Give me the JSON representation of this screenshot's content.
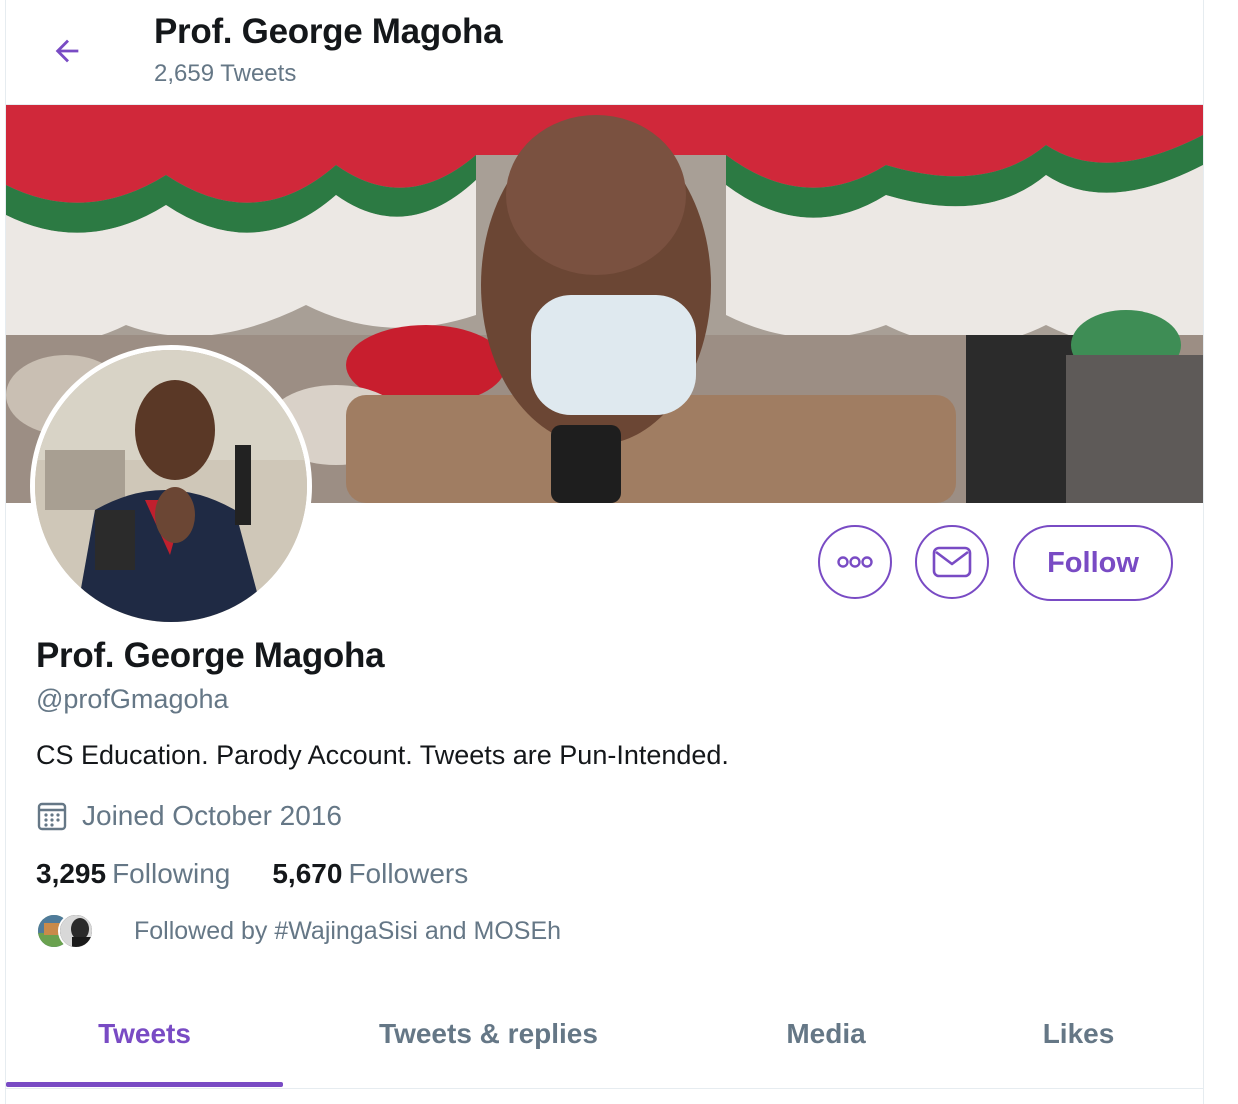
{
  "header": {
    "title": "Prof. George Magoha",
    "tweet_count": "2,659 Tweets"
  },
  "profile": {
    "name": "Prof. George Magoha",
    "handle": "@profGmagoha",
    "bio": "CS Education. Parody Account. Tweets are Pun-Intended.",
    "joined": "Joined October 2016",
    "following_count": "3,295",
    "following_label": "Following",
    "followers_count": "5,670",
    "followers_label": "Followers",
    "followed_by": "Followed by #WajingaSisi and MOSEh"
  },
  "actions": {
    "more_icon": "more-icon",
    "message_icon": "envelope-icon",
    "follow_label": "Follow"
  },
  "tabs": [
    {
      "label": "Tweets",
      "active": true
    },
    {
      "label": "Tweets & replies",
      "active": false
    },
    {
      "label": "Media",
      "active": false
    },
    {
      "label": "Likes",
      "active": false
    }
  ],
  "colors": {
    "accent": "#794bc4",
    "secondary_text": "#657786"
  }
}
